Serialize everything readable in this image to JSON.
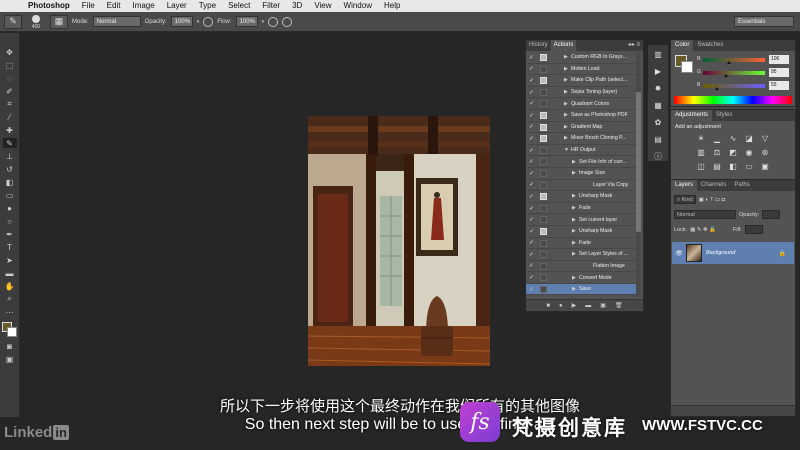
{
  "menubar": {
    "apple": "",
    "items": [
      "Photoshop",
      "File",
      "Edit",
      "Image",
      "Layer",
      "Type",
      "Select",
      "Filter",
      "3D",
      "View",
      "Window",
      "Help"
    ]
  },
  "options": {
    "brush_size": "400",
    "mode_label": "Mode:",
    "mode_value": "Normal",
    "opacity_label": "Opacity:",
    "opacity_value": "100%",
    "flow_label": "Flow:",
    "flow_value": "100%",
    "workspace": "Essentials"
  },
  "actions_panel": {
    "tabs": [
      "History",
      "Actions"
    ],
    "menu": "▸▸ ≡",
    "rows": [
      {
        "label": "Custom RGB to Grays...",
        "indent": 0,
        "dialog": true,
        "open": false
      },
      {
        "label": "Molten Lead",
        "indent": 0,
        "dialog": false,
        "open": false
      },
      {
        "label": "Make Clip Path (select...",
        "indent": 0,
        "dialog": true,
        "open": false
      },
      {
        "label": "Sepia Toning (layer)",
        "indent": 0,
        "dialog": false,
        "open": false
      },
      {
        "label": "Quadrant Colors",
        "indent": 0,
        "dialog": false,
        "open": false
      },
      {
        "label": "Save as Photoshop PDF",
        "indent": 0,
        "dialog": true,
        "open": false
      },
      {
        "label": "Gradient Map",
        "indent": 0,
        "dialog": true,
        "open": false
      },
      {
        "label": "Mixer Brush Cloning P...",
        "indent": 0,
        "dialog": true,
        "open": false
      },
      {
        "label": "HR Output",
        "indent": 0,
        "dialog": false,
        "open": true
      },
      {
        "label": "Set File Info of curr...",
        "indent": 1,
        "dialog": false,
        "open": false
      },
      {
        "label": "Image Size",
        "indent": 1,
        "dialog": false,
        "open": false
      },
      {
        "label": "Layer Via Copy",
        "indent": 2,
        "dialog": false,
        "open": false
      },
      {
        "label": "Unsharp Mask",
        "indent": 1,
        "dialog": true,
        "open": false
      },
      {
        "label": "Fade",
        "indent": 1,
        "dialog": false,
        "open": false
      },
      {
        "label": "Set current layer",
        "indent": 1,
        "dialog": false,
        "open": false
      },
      {
        "label": "Unsharp Mask",
        "indent": 1,
        "dialog": true,
        "open": false
      },
      {
        "label": "Fade",
        "indent": 1,
        "dialog": false,
        "open": false
      },
      {
        "label": "Set Layer Styles of ...",
        "indent": 1,
        "dialog": false,
        "open": false
      },
      {
        "label": "Flatten Image",
        "indent": 2,
        "dialog": false,
        "open": false
      },
      {
        "label": "Convert Mode",
        "indent": 1,
        "dialog": false,
        "open": false
      },
      {
        "label": "Save",
        "indent": 1,
        "dialog": false,
        "open": false,
        "selected": true
      }
    ]
  },
  "color_panel": {
    "tabs": [
      "Color",
      "Swatches"
    ],
    "r_label": "R",
    "r_value": "106",
    "r_level": 0.42,
    "g_label": "G",
    "g_value": "95",
    "g_level": 0.37,
    "b_label": "B",
    "b_value": "55",
    "b_level": 0.22
  },
  "adjustments_panel": {
    "tabs": [
      "Adjustments",
      "Styles"
    ],
    "title": "Add an adjustment"
  },
  "layers_panel": {
    "tabs": [
      "Layers",
      "Channels",
      "Paths"
    ],
    "kind": "Kind",
    "blend": "Normal",
    "opacity_label": "Opacity:",
    "lock_label": "Lock:",
    "fill_label": "Fill:",
    "layer_name": "Background"
  },
  "subtitles": {
    "cn": "所以下一步将使用这个最终动作在我们所有的其他图像",
    "en": "So then next step will be to use this final act"
  },
  "branding": {
    "linkedin": "Linked",
    "linkedin_in": "in",
    "wm_logo": "fs",
    "wm_cn": "梵摄创意库",
    "wm_url": "WWW.FSTVC.CC"
  }
}
